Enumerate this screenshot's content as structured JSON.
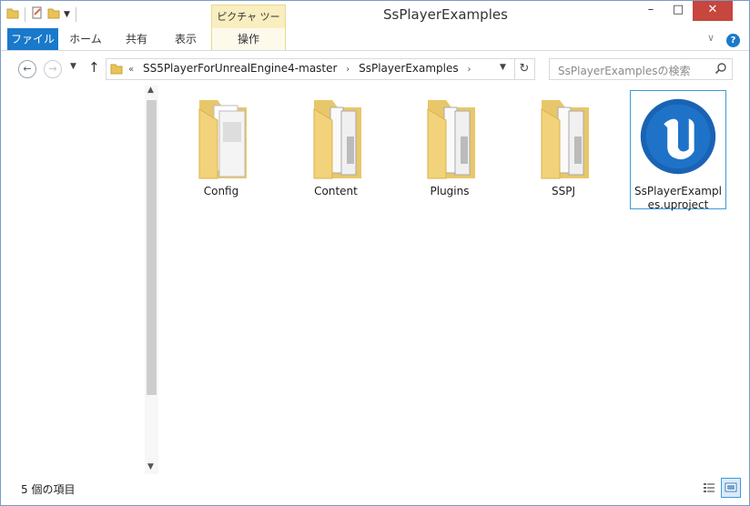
{
  "window": {
    "title": "SsPlayerExamples",
    "minimize_glyph": "–",
    "maximize_glyph": "□",
    "close_glyph": "✕"
  },
  "ribbon": {
    "context_group": "ピクチャ ツール",
    "tabs": [
      "ファイル",
      "ホーム",
      "共有",
      "表示",
      "操作"
    ],
    "expand_glyph": "∨",
    "help_glyph": "?"
  },
  "nav": {
    "back_glyph": "←",
    "forward_glyph": "→",
    "recent_glyph": "▼",
    "up_glyph": "↑",
    "address_prefix": "«",
    "breadcrumbs": [
      "SS5PlayerForUnrealEngine4-master",
      "SsPlayerExamples"
    ],
    "breadcrumb_separator": "›",
    "refresh_glyph": "↻",
    "search_placeholder": "SsPlayerExamplesの検索"
  },
  "files": [
    {
      "name": "Config",
      "type": "folder",
      "icon": "folder-with-documents-icon"
    },
    {
      "name": "Content",
      "type": "folder",
      "icon": "folder-icon"
    },
    {
      "name": "Plugins",
      "type": "folder",
      "icon": "folder-icon"
    },
    {
      "name": "SSPJ",
      "type": "folder",
      "icon": "folder-icon"
    },
    {
      "name": "SsPlayerExampl es.uproject",
      "line1": "SsPlayerExampl",
      "line2": "es.uproject",
      "type": "uproject",
      "icon": "unreal-engine-icon",
      "selected": true
    }
  ],
  "status": {
    "item_count": "5 個の項目"
  },
  "colors": {
    "ribbon_file_tab": "#1979ca",
    "close_button": "#c7463d",
    "context_tab": "#f9eec0",
    "selection_border": "#3c9bd6",
    "folder": "#f2d27a"
  }
}
